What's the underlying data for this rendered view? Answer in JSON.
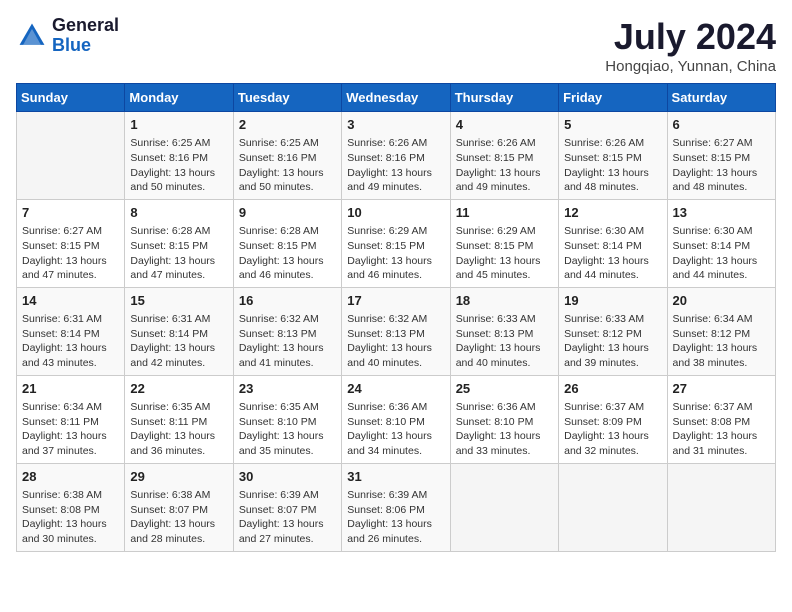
{
  "header": {
    "logo_line1": "General",
    "logo_line2": "Blue",
    "month": "July 2024",
    "location": "Hongqiao, Yunnan, China"
  },
  "days_of_week": [
    "Sunday",
    "Monday",
    "Tuesday",
    "Wednesday",
    "Thursday",
    "Friday",
    "Saturday"
  ],
  "weeks": [
    [
      {
        "day": "",
        "info": ""
      },
      {
        "day": "1",
        "info": "Sunrise: 6:25 AM\nSunset: 8:16 PM\nDaylight: 13 hours\nand 50 minutes."
      },
      {
        "day": "2",
        "info": "Sunrise: 6:25 AM\nSunset: 8:16 PM\nDaylight: 13 hours\nand 50 minutes."
      },
      {
        "day": "3",
        "info": "Sunrise: 6:26 AM\nSunset: 8:16 PM\nDaylight: 13 hours\nand 49 minutes."
      },
      {
        "day": "4",
        "info": "Sunrise: 6:26 AM\nSunset: 8:15 PM\nDaylight: 13 hours\nand 49 minutes."
      },
      {
        "day": "5",
        "info": "Sunrise: 6:26 AM\nSunset: 8:15 PM\nDaylight: 13 hours\nand 48 minutes."
      },
      {
        "day": "6",
        "info": "Sunrise: 6:27 AM\nSunset: 8:15 PM\nDaylight: 13 hours\nand 48 minutes."
      }
    ],
    [
      {
        "day": "7",
        "info": "Sunrise: 6:27 AM\nSunset: 8:15 PM\nDaylight: 13 hours\nand 47 minutes."
      },
      {
        "day": "8",
        "info": "Sunrise: 6:28 AM\nSunset: 8:15 PM\nDaylight: 13 hours\nand 47 minutes."
      },
      {
        "day": "9",
        "info": "Sunrise: 6:28 AM\nSunset: 8:15 PM\nDaylight: 13 hours\nand 46 minutes."
      },
      {
        "day": "10",
        "info": "Sunrise: 6:29 AM\nSunset: 8:15 PM\nDaylight: 13 hours\nand 46 minutes."
      },
      {
        "day": "11",
        "info": "Sunrise: 6:29 AM\nSunset: 8:15 PM\nDaylight: 13 hours\nand 45 minutes."
      },
      {
        "day": "12",
        "info": "Sunrise: 6:30 AM\nSunset: 8:14 PM\nDaylight: 13 hours\nand 44 minutes."
      },
      {
        "day": "13",
        "info": "Sunrise: 6:30 AM\nSunset: 8:14 PM\nDaylight: 13 hours\nand 44 minutes."
      }
    ],
    [
      {
        "day": "14",
        "info": "Sunrise: 6:31 AM\nSunset: 8:14 PM\nDaylight: 13 hours\nand 43 minutes."
      },
      {
        "day": "15",
        "info": "Sunrise: 6:31 AM\nSunset: 8:14 PM\nDaylight: 13 hours\nand 42 minutes."
      },
      {
        "day": "16",
        "info": "Sunrise: 6:32 AM\nSunset: 8:13 PM\nDaylight: 13 hours\nand 41 minutes."
      },
      {
        "day": "17",
        "info": "Sunrise: 6:32 AM\nSunset: 8:13 PM\nDaylight: 13 hours\nand 40 minutes."
      },
      {
        "day": "18",
        "info": "Sunrise: 6:33 AM\nSunset: 8:13 PM\nDaylight: 13 hours\nand 40 minutes."
      },
      {
        "day": "19",
        "info": "Sunrise: 6:33 AM\nSunset: 8:12 PM\nDaylight: 13 hours\nand 39 minutes."
      },
      {
        "day": "20",
        "info": "Sunrise: 6:34 AM\nSunset: 8:12 PM\nDaylight: 13 hours\nand 38 minutes."
      }
    ],
    [
      {
        "day": "21",
        "info": "Sunrise: 6:34 AM\nSunset: 8:11 PM\nDaylight: 13 hours\nand 37 minutes."
      },
      {
        "day": "22",
        "info": "Sunrise: 6:35 AM\nSunset: 8:11 PM\nDaylight: 13 hours\nand 36 minutes."
      },
      {
        "day": "23",
        "info": "Sunrise: 6:35 AM\nSunset: 8:10 PM\nDaylight: 13 hours\nand 35 minutes."
      },
      {
        "day": "24",
        "info": "Sunrise: 6:36 AM\nSunset: 8:10 PM\nDaylight: 13 hours\nand 34 minutes."
      },
      {
        "day": "25",
        "info": "Sunrise: 6:36 AM\nSunset: 8:10 PM\nDaylight: 13 hours\nand 33 minutes."
      },
      {
        "day": "26",
        "info": "Sunrise: 6:37 AM\nSunset: 8:09 PM\nDaylight: 13 hours\nand 32 minutes."
      },
      {
        "day": "27",
        "info": "Sunrise: 6:37 AM\nSunset: 8:08 PM\nDaylight: 13 hours\nand 31 minutes."
      }
    ],
    [
      {
        "day": "28",
        "info": "Sunrise: 6:38 AM\nSunset: 8:08 PM\nDaylight: 13 hours\nand 30 minutes."
      },
      {
        "day": "29",
        "info": "Sunrise: 6:38 AM\nSunset: 8:07 PM\nDaylight: 13 hours\nand 28 minutes."
      },
      {
        "day": "30",
        "info": "Sunrise: 6:39 AM\nSunset: 8:07 PM\nDaylight: 13 hours\nand 27 minutes."
      },
      {
        "day": "31",
        "info": "Sunrise: 6:39 AM\nSunset: 8:06 PM\nDaylight: 13 hours\nand 26 minutes."
      },
      {
        "day": "",
        "info": ""
      },
      {
        "day": "",
        "info": ""
      },
      {
        "day": "",
        "info": ""
      }
    ]
  ]
}
